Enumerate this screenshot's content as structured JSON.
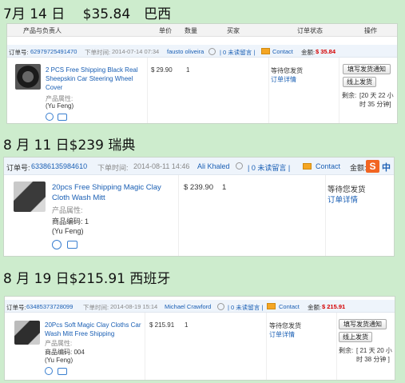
{
  "headings": {
    "h1": "7月 14 日　  $35.84　巴西",
    "h2": "8 月 11 日$239 瑞典",
    "h3": "8 月 19 日$215.91 西班牙"
  },
  "columns": {
    "product": "产品与负责人",
    "price": "单价",
    "qty": "数量",
    "buyer": "买家",
    "status": "订单状态",
    "action": "操作"
  },
  "labels": {
    "order_no": "订单号:",
    "order_time": "下单时间:",
    "unread": "| 0 未读留言 |",
    "contact": "Contact",
    "amount": "金额:",
    "attrs": "产品属性:",
    "status": "等待您发货",
    "details": "订单详情",
    "remaining": "剩余:",
    "btn_notify": "填写发货通知",
    "btn_ship": "线上发货"
  },
  "orders": [
    {
      "order_no": "62979725491470",
      "time": "2014-07-14 07:34",
      "buyer": "fausto oliveira",
      "amount": "$ 35.84",
      "product": "2 PCS Free Shipping Black Real Sheepskin Car Steering Wheel Cover",
      "price": "$ 29.90",
      "qty": "1",
      "owner": "(Yu Feng)",
      "remaining_time": "[20 天 22 小时 35 分钟]"
    },
    {
      "order_no": "63386135984610",
      "time": "2014-08-11 14:46",
      "buyer": "Ali Khaled",
      "amount": "",
      "product": "20pcs Free Shipping Magic Clay Cloth Wash Mitt",
      "price": "$ 239.90",
      "qty": "1",
      "code": "商品编码: 1",
      "owner": "(Yu Feng)"
    },
    {
      "order_no": "63485373728099",
      "time": "2014-08-19 15:14",
      "buyer": "Michael Crawford",
      "amount": "$ 215.91",
      "product": "20Pcs Soft Magic Clay Cloths Car Wash Mitt Free Shipping",
      "price": "$ 215.91",
      "qty": "1",
      "code": "商品编码: 004",
      "owner": "(Yu Feng)",
      "remaining_time": "[ 21 天 20 小时 38 分钟 ]"
    }
  ],
  "sogou": {
    "s": "S",
    "zh": "中"
  }
}
